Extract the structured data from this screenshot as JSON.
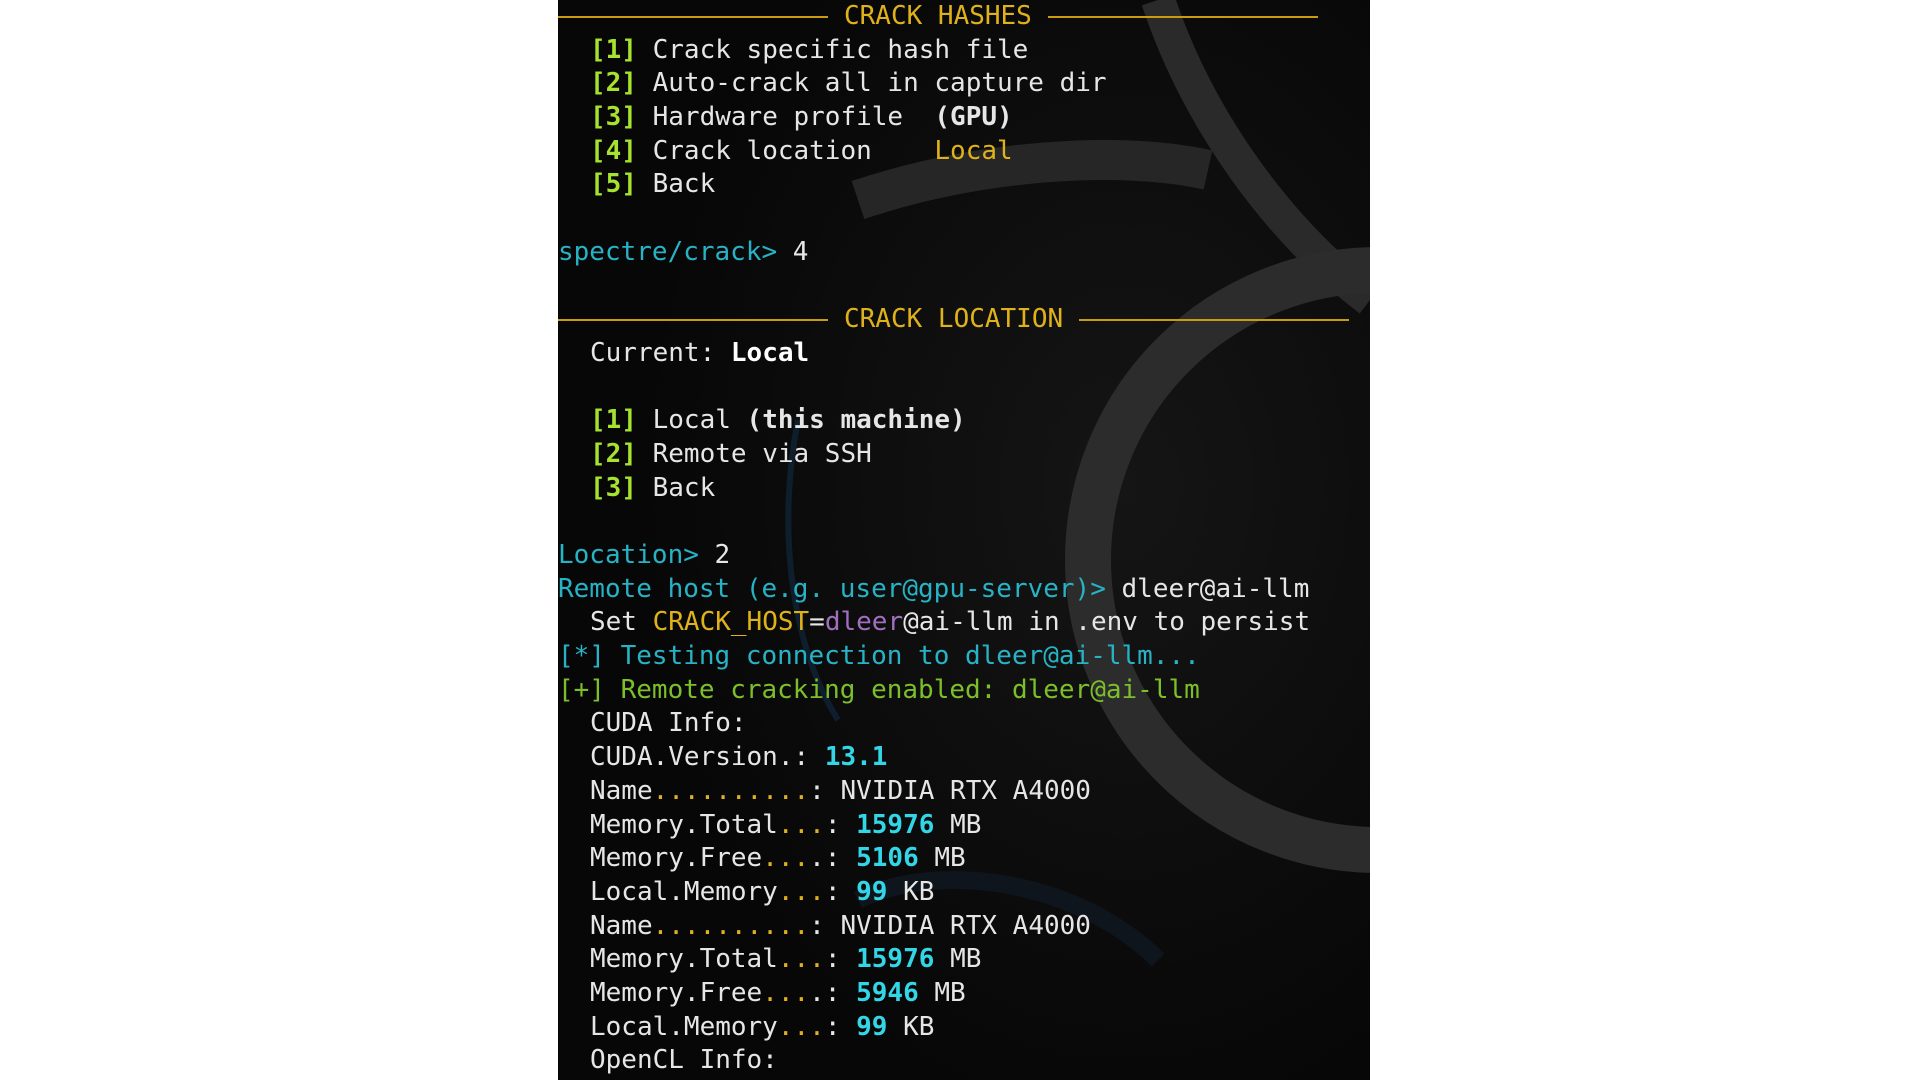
{
  "colors": {
    "background": "#0b0b0b",
    "menu_key": "#a6e22e",
    "prompt": "#27b3c5",
    "header": "#e0b21a",
    "value_highlight": "#33d6e6",
    "success": "#7cbf2a",
    "username": "#a06fbf"
  },
  "crack_hashes": {
    "title": "CRACK HASHES",
    "items": [
      {
        "key": "[1]",
        "label": "Crack specific hash file"
      },
      {
        "key": "[2]",
        "label": "Auto-crack all in capture dir"
      },
      {
        "key": "[3]",
        "label": "Hardware profile  ",
        "extra": "(GPU)"
      },
      {
        "key": "[4]",
        "label": "Crack location    ",
        "extra": "Local"
      },
      {
        "key": "[5]",
        "label": "Back"
      }
    ]
  },
  "prompt1": {
    "prompt": "spectre/crack>",
    "input": " 4"
  },
  "crack_location": {
    "title": "CRACK LOCATION",
    "current_label": "Current: ",
    "current_value": "Local",
    "items": [
      {
        "key": "[1]",
        "label": "Local ",
        "extra": "(this machine)"
      },
      {
        "key": "[2]",
        "label": "Remote via SSH"
      },
      {
        "key": "[3]",
        "label": "Back"
      }
    ]
  },
  "prompt2": {
    "prompt": "Location>",
    "input": " 2"
  },
  "prompt3": {
    "prompt": "Remote host (e.g. user@gpu-server)>",
    "input": " dleer@ai-llm"
  },
  "hint": {
    "prefix": "Set ",
    "var": "CRACK_HOST",
    "eq": "=",
    "user": "dleer",
    "host": "@ai-llm in .env to persist"
  },
  "status_testing": {
    "tag": "[*]",
    "text": " Testing connection to dleer@ai-llm..."
  },
  "status_enabled": {
    "tag": "[+]",
    "text": " Remote cracking enabled: dleer@ai-llm"
  },
  "cuda": {
    "header": "CUDA Info:",
    "version_label": "CUDA.Version.",
    "version_value": "13.1",
    "devices": [
      {
        "name": "NVIDIA RTX A4000",
        "memory_total": "15976",
        "memory_free": "5106",
        "local_memory": "99"
      },
      {
        "name": "NVIDIA RTX A4000",
        "memory_total": "15976",
        "memory_free": "5946",
        "local_memory": "99"
      }
    ],
    "labels": {
      "name": "Name",
      "name_dots": "..........",
      "memory_total": "Memory.Total",
      "memory_total_dots": "...",
      "memory_free": "Memory.Free",
      "memory_free_dots": "...",
      "local_memory": "Local.Memory",
      "local_memory_dots": "...",
      "unit_mb": "MB",
      "unit_kb": "KB"
    }
  },
  "opencl": {
    "header": "OpenCL Info:"
  }
}
